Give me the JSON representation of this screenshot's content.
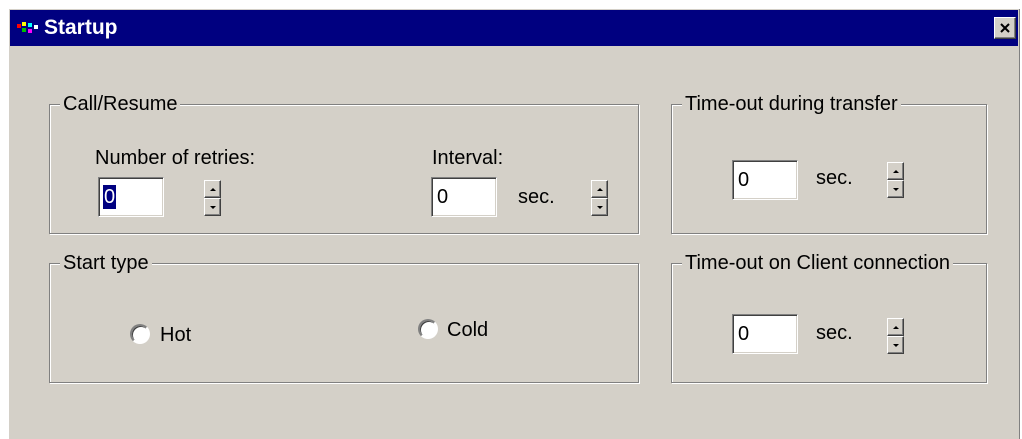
{
  "window": {
    "title": "Startup",
    "close_label": "×"
  },
  "call_resume": {
    "legend": "Call/Resume",
    "retries_label": "Number of retries:",
    "retries_value": "0",
    "interval_label": "Interval:",
    "interval_value": "0",
    "interval_unit": "sec."
  },
  "start_type": {
    "legend": "Start type",
    "options": [
      {
        "label": "Hot",
        "selected": false
      },
      {
        "label": "Cold",
        "selected": false
      }
    ]
  },
  "timeout_transfer": {
    "legend": "Time-out during transfer",
    "value": "0",
    "unit": "sec."
  },
  "timeout_client": {
    "legend": "Time-out on Client connection",
    "value": "0",
    "unit": "sec."
  },
  "colors": {
    "titlebar": "#000080",
    "dialog_face": "#d4d0c8",
    "selection": "#000080"
  },
  "icons": [
    "app-icon",
    "close-icon",
    "spin-up-arrow-icon",
    "spin-down-arrow-icon"
  ]
}
